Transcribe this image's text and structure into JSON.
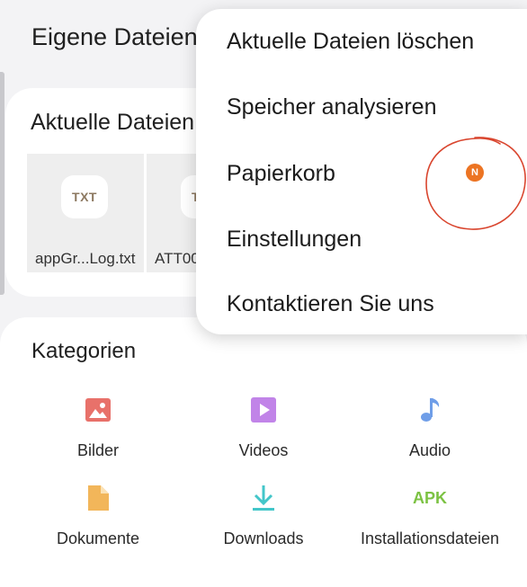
{
  "header": {
    "title": "Eigene Dateien"
  },
  "recent": {
    "title": "Aktuelle Dateien",
    "files": [
      {
        "type": "TXT",
        "name": "appGr...Log.txt"
      },
      {
        "type": "TXT",
        "name": "ATT00"
      }
    ]
  },
  "categories": {
    "title": "Kategorien",
    "items": [
      {
        "label": "Bilder",
        "icon": "image-icon",
        "color": "#e8716a"
      },
      {
        "label": "Videos",
        "icon": "video-icon",
        "color": "#c184e8"
      },
      {
        "label": "Audio",
        "icon": "music-note-icon",
        "color": "#6f9ee8"
      },
      {
        "label": "Dokumente",
        "icon": "document-icon",
        "color": "#f2b65a"
      },
      {
        "label": "Downloads",
        "icon": "download-icon",
        "color": "#43c6c9"
      },
      {
        "label": "Installationsdateien",
        "icon": "apk-icon",
        "icon_text": "APK",
        "color": "#7cc243"
      }
    ]
  },
  "menu": {
    "items": [
      {
        "label": "Aktuelle Dateien löschen"
      },
      {
        "label": "Speicher analysieren"
      },
      {
        "label": "Papierkorb",
        "badge": "N"
      },
      {
        "label": "Einstellungen"
      },
      {
        "label": "Kontaktieren Sie uns"
      }
    ]
  },
  "colors": {
    "badge": "#ec7423",
    "annotation_circle": "#d9462f",
    "background": "#f3f3f5",
    "card": "#ffffff"
  }
}
